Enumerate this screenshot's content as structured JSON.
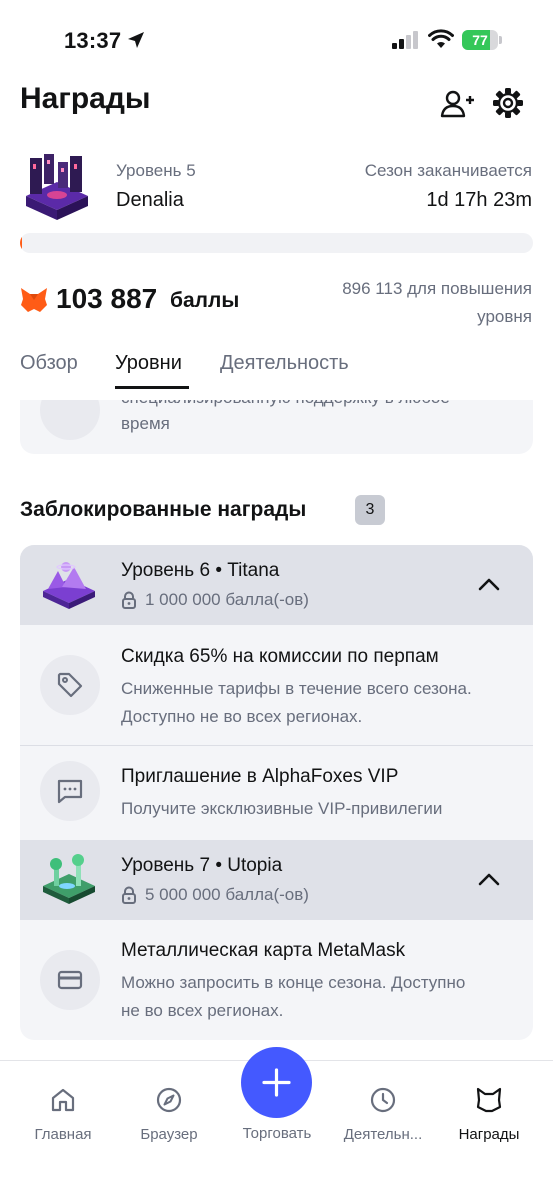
{
  "status_bar": {
    "time": "13:37",
    "battery": "77",
    "battery_level": 0.77
  },
  "header": {
    "title": "Награды"
  },
  "season": {
    "level_label": "Уровень 5",
    "level_name": "Denalia",
    "ends_label": "Сезон заканчивается",
    "ends_value": "1d 17h 23m",
    "progress_fraction": 0.004
  },
  "points": {
    "value": "103 887",
    "unit": "баллы",
    "needed_line1": "896 113 для повышения",
    "needed_line2": "уровня"
  },
  "tabs": [
    {
      "label": "Обзор",
      "active": false
    },
    {
      "label": "Уровни",
      "active": true
    },
    {
      "label": "Деятельность",
      "active": false
    }
  ],
  "previous_reward": {
    "line1": "специализированную поддержку в любое",
    "line2": "время"
  },
  "locked": {
    "title": "Заблокированные награды",
    "count": "3",
    "levels": [
      {
        "title": "Уровень 6 • Titana",
        "requirement": "1 000 000 балла(-ов)",
        "rewards": [
          {
            "title": "Скидка 65% на комиссии по перпам",
            "desc_line1": "Сниженные тарифы в течение всего сезона.",
            "desc_line2": "Доступно не во всех регионах.",
            "icon": "tag-icon"
          },
          {
            "title": "Приглашение в AlphaFoxes VIP",
            "desc_line1": "Получите эксклюзивные VIP-привилегии",
            "icon": "chat-bubble-icon"
          }
        ]
      },
      {
        "title": "Уровень 7 • Utopia",
        "requirement": "5 000 000 балла(-ов)",
        "rewards": [
          {
            "title": "Металлическая карта MetaMask",
            "desc_line1": "Можно запросить в конце сезона. Доступно",
            "desc_line2": "не во всех регионах.",
            "icon": "credit-card-icon"
          }
        ]
      }
    ]
  },
  "bottom_nav": [
    {
      "label": "Главная",
      "icon": "home-icon"
    },
    {
      "label": "Браузер",
      "icon": "compass-icon"
    },
    {
      "label": "Торговать",
      "icon": "plus-icon"
    },
    {
      "label": "Деятельн...",
      "icon": "clock-icon"
    },
    {
      "label": "Награды",
      "icon": "fox-icon",
      "active": true
    }
  ],
  "colors": {
    "accent": "#4459ff",
    "progress": "#ff5c16",
    "battery": "#34c759"
  }
}
